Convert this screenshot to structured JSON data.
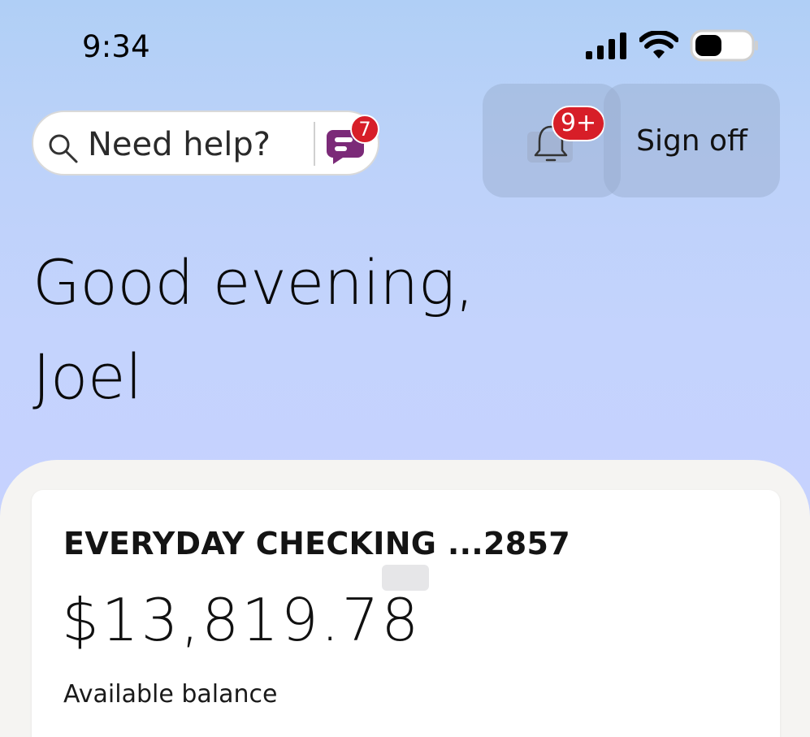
{
  "status_bar": {
    "time": "9:34",
    "icons": [
      "cellular-signal-icon",
      "wifi-icon",
      "battery-icon"
    ]
  },
  "header": {
    "help_search": {
      "placeholder": "Need help?",
      "icon": "search-icon",
      "chat_icon": "assistant-chat-icon",
      "chat_badge": "7"
    },
    "notifications": {
      "icon": "bell-icon",
      "badge": "9+"
    },
    "sign_off_label": "Sign off"
  },
  "greeting": {
    "line1": "Good evening,",
    "line2": "Joel"
  },
  "account": {
    "title": "EVERYDAY CHECKING ...2857",
    "balance": "$13,819.78",
    "balance_label": "Available balance"
  },
  "colors": {
    "badge_red": "#d71e28",
    "chat_purple": "#7b2a78",
    "background_blue": "#c4d3fd",
    "panel_gray": "#f5f4f2"
  }
}
